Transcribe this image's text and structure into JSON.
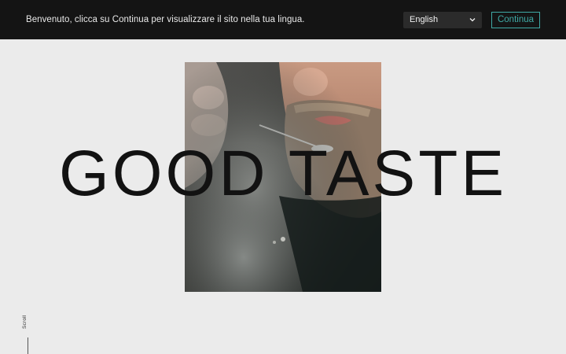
{
  "banner": {
    "message": "Benvenuto, clicca su Continua per visualizzare il sito nella tua lingua.",
    "language_selected": "English",
    "continue_label": "Continua",
    "accent_color": "#3fa9a5"
  },
  "hero": {
    "title": "GOOD TASTE",
    "image_alt": "bearded man tasting from a spoon amid steam"
  },
  "scroll": {
    "label": "Scroll"
  }
}
